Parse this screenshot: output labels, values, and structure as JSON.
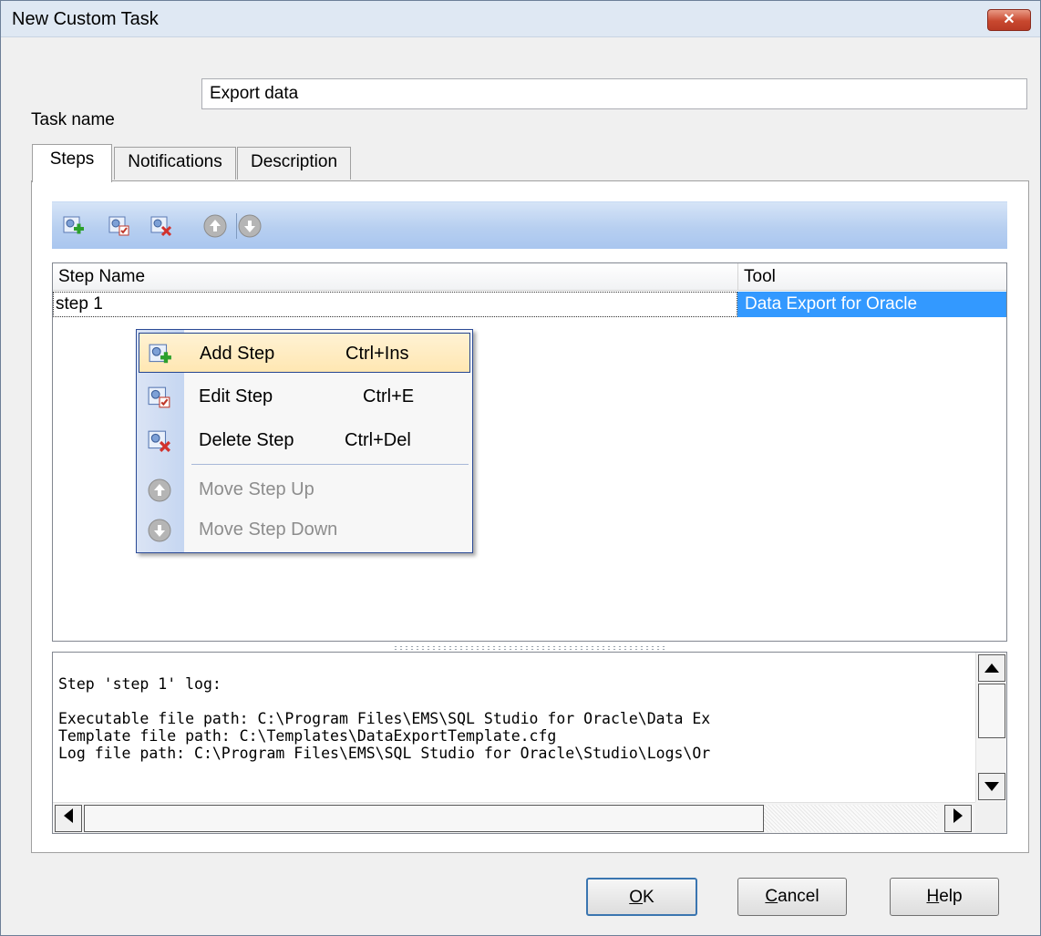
{
  "window": {
    "title": "New Custom Task",
    "close_label": "✕"
  },
  "task": {
    "label": "Task name",
    "value": "Export data"
  },
  "tabs": [
    {
      "label": "Steps",
      "active": true
    },
    {
      "label": "Notifications",
      "active": false
    },
    {
      "label": "Description",
      "active": false
    }
  ],
  "toolbar": {
    "icons": [
      "add-step-icon",
      "edit-step-icon",
      "delete-step-icon",
      "move-up-icon",
      "move-down-icon"
    ]
  },
  "grid": {
    "columns": [
      "Step Name",
      "Tool"
    ],
    "rows": [
      {
        "name": "step 1",
        "tool": "Data Export for Oracle"
      }
    ]
  },
  "context_menu": {
    "items": [
      {
        "label": "Add Step",
        "shortcut": "Ctrl+Ins",
        "icon": "add-step-icon",
        "enabled": true,
        "highlighted": true
      },
      {
        "label": "Edit Step",
        "shortcut": "Ctrl+E",
        "icon": "edit-step-icon",
        "enabled": true
      },
      {
        "label": "Delete Step",
        "shortcut": "Ctrl+Del",
        "icon": "delete-step-icon",
        "enabled": true
      },
      {
        "label": "Move Step Up",
        "shortcut": "",
        "icon": "move-up-icon",
        "enabled": false
      },
      {
        "label": "Move Step Down",
        "shortcut": "",
        "icon": "move-down-icon",
        "enabled": false
      }
    ]
  },
  "log": {
    "lines": [
      "Step 'step 1' log:",
      "",
      "Executable file path: C:\\Program Files\\EMS\\SQL Studio for Oracle\\Data Ex",
      "Template file path: C:\\Templates\\DataExportTemplate.cfg",
      "Log file path: C:\\Program Files\\EMS\\SQL Studio for Oracle\\Studio\\Logs\\Or"
    ]
  },
  "buttons": {
    "ok": {
      "mnemonic": "O",
      "rest": "K"
    },
    "cancel": {
      "mnemonic": "C",
      "rest": "ancel"
    },
    "help": {
      "mnemonic": "H",
      "rest": "elp"
    }
  },
  "colors": {
    "selection": "#3399ff",
    "toolbar": "#b7cff0",
    "menu_highlight": "#ffe7b2"
  }
}
